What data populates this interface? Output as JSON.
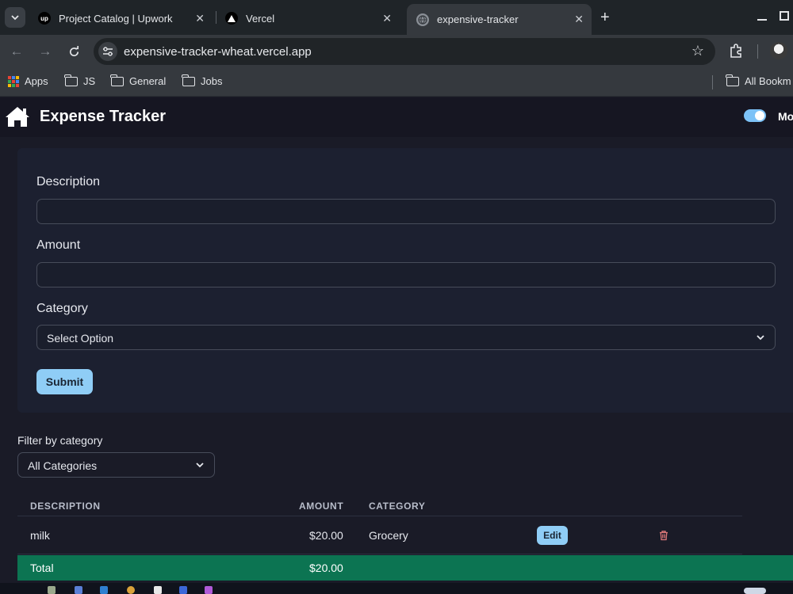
{
  "browser": {
    "tabs": [
      {
        "title": "Project Catalog | Upwork",
        "favicon": "upwork-icon",
        "active": false
      },
      {
        "title": "Vercel",
        "favicon": "vercel-icon",
        "active": false
      },
      {
        "title": "expensive-tracker",
        "favicon": "globe-icon",
        "active": true
      }
    ],
    "url": "expensive-tracker-wheat.vercel.app",
    "bookmarks": [
      {
        "label": "Apps",
        "icon": "apps-grid-icon"
      },
      {
        "label": "JS",
        "icon": "folder-icon"
      },
      {
        "label": "General",
        "icon": "folder-icon"
      },
      {
        "label": "Jobs",
        "icon": "folder-icon"
      }
    ],
    "all_bookmarks_label": "All Bookm"
  },
  "app": {
    "title": "Expense Tracker",
    "mode_label": "Mo",
    "mode_enabled": true
  },
  "form": {
    "description_label": "Description",
    "description_value": "",
    "amount_label": "Amount",
    "amount_value": "",
    "category_label": "Category",
    "category_selected": "Select Option",
    "submit_label": "Submit"
  },
  "filter": {
    "label": "Filter by category",
    "selected": "All Categories"
  },
  "table": {
    "columns": [
      "DESCRIPTION",
      "AMOUNT",
      "CATEGORY"
    ],
    "rows": [
      {
        "description": "milk",
        "amount": "$20.00",
        "category": "Grocery",
        "edit_label": "Edit"
      }
    ],
    "total_label": "Total",
    "total_amount": "$20.00"
  },
  "colors": {
    "accent": "#8fcdf6",
    "total_bg": "#0c7452",
    "delete": "#e07a7a",
    "page_bg": "#1a1b27"
  }
}
